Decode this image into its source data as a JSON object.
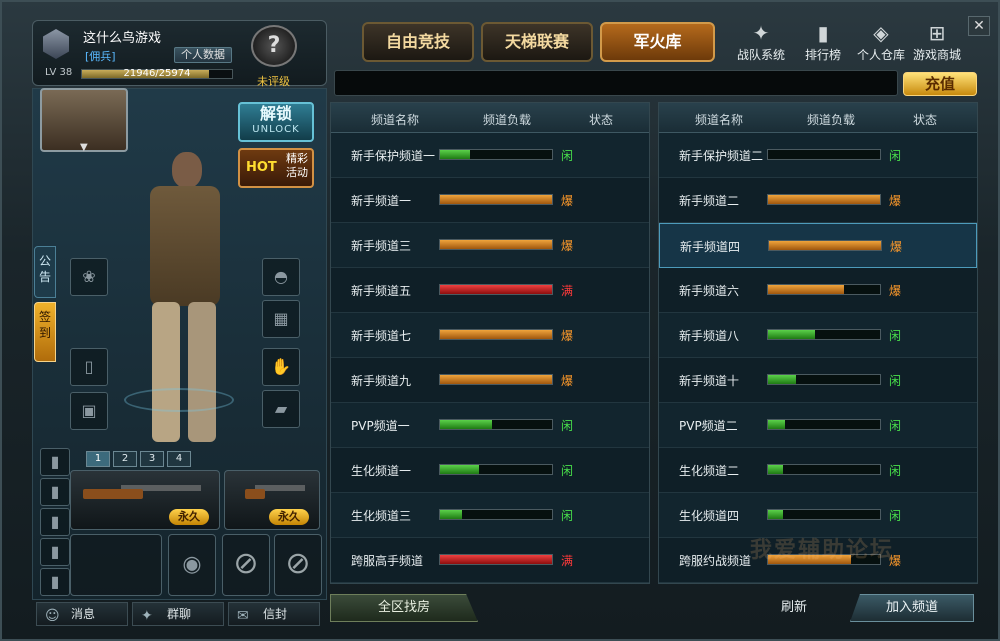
{
  "profile": {
    "nickname": "这什么鸟游戏",
    "rank_title": "[佣兵]",
    "personal_data": "个人数据",
    "level": "LV 38",
    "exp_text": "21946/25974",
    "exp_fraction": 0.845,
    "rating": "未评级"
  },
  "tabs": [
    "自由竞技",
    "天梯联赛",
    "军火库"
  ],
  "nav": {
    "team": "战队系统",
    "ranking": "排行榜",
    "warehouse": "个人仓库",
    "store": "游戏商城"
  },
  "recharge": "充值",
  "unlock": {
    "title": "解锁",
    "sub": "UNLOCK"
  },
  "hot": {
    "tag": "HOT",
    "text": "精彩活动"
  },
  "side_tabs": {
    "notice": "公告",
    "signin": "签到"
  },
  "weapon_tabs": [
    "1",
    "2",
    "3",
    "4"
  ],
  "permanent": "永久",
  "channel_headers": {
    "name": "频道名称",
    "load": "频道负载",
    "status": "状态"
  },
  "channels_left": [
    {
      "name": "新手保护频道一",
      "load": 0.27,
      "level": "g",
      "status": "闲"
    },
    {
      "name": "新手频道一",
      "load": 1.0,
      "level": "o",
      "status": "爆"
    },
    {
      "name": "新手频道三",
      "load": 1.0,
      "level": "o",
      "status": "爆"
    },
    {
      "name": "新手频道五",
      "load": 1.0,
      "level": "r",
      "status": "满"
    },
    {
      "name": "新手频道七",
      "load": 1.0,
      "level": "o",
      "status": "爆"
    },
    {
      "name": "新手频道九",
      "load": 1.0,
      "level": "o",
      "status": "爆"
    },
    {
      "name": "PVP频道一",
      "load": 0.46,
      "level": "g",
      "status": "闲"
    },
    {
      "name": "生化频道一",
      "load": 0.35,
      "level": "g",
      "status": "闲"
    },
    {
      "name": "生化频道三",
      "load": 0.2,
      "level": "g",
      "status": "闲"
    },
    {
      "name": "跨服高手频道",
      "load": 1.0,
      "level": "r",
      "status": "满"
    }
  ],
  "channels_right": [
    {
      "name": "新手保护频道二",
      "load": 0.0,
      "level": "g",
      "status": "闲"
    },
    {
      "name": "新手频道二",
      "load": 1.0,
      "level": "o",
      "status": "爆"
    },
    {
      "name": "新手频道四",
      "load": 1.0,
      "level": "o",
      "status": "爆"
    },
    {
      "name": "新手频道六",
      "load": 0.68,
      "level": "o",
      "status": "爆"
    },
    {
      "name": "新手频道八",
      "load": 0.42,
      "level": "g",
      "status": "闲"
    },
    {
      "name": "新手频道十",
      "load": 0.25,
      "level": "g",
      "status": "闲"
    },
    {
      "name": "PVP频道二",
      "load": 0.15,
      "level": "g",
      "status": "闲"
    },
    {
      "name": "生化频道二",
      "load": 0.13,
      "level": "g",
      "status": "闲"
    },
    {
      "name": "生化频道四",
      "load": 0.13,
      "level": "g",
      "status": "闲"
    },
    {
      "name": "跨服约战频道",
      "load": 0.74,
      "level": "o",
      "status": "爆"
    }
  ],
  "selected_channel_right": 2,
  "bottom": {
    "messages": "消息",
    "group_chat": "群聊",
    "mail": "信封",
    "find_room": "全区找房",
    "refresh": "刷新",
    "join_channel": "加入频道"
  },
  "watermark": "我爱辅助论坛"
}
